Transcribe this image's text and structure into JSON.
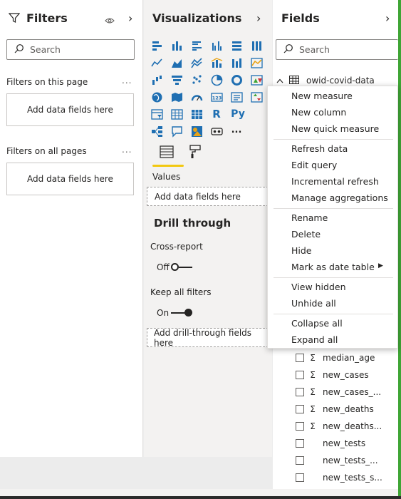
{
  "filters": {
    "title": "Filters",
    "search_placeholder": "Search",
    "on_this_page_label": "Filters on this page",
    "on_all_pages_label": "Filters on all pages",
    "add_fields_text": "Add data fields here",
    "more": "..."
  },
  "visualizations": {
    "title": "Visualizations",
    "values_label": "Values",
    "values_drop": "Add data fields here",
    "drill_title": "Drill through",
    "cross_report_label": "Cross-report",
    "cross_report_state": "Off",
    "keep_filters_label": "Keep all filters",
    "keep_filters_state": "On",
    "drill_drop": "Add drill-through fields here",
    "more_visuals": "...",
    "r_visual": "R",
    "py_visual": "Py"
  },
  "fields": {
    "title": "Fields",
    "search_placeholder": "Search",
    "table_name": "owid-covid-data",
    "items": [
      {
        "name": "median_age",
        "sigma": "Σ"
      },
      {
        "name": "new_cases",
        "sigma": "Σ"
      },
      {
        "name": "new_cases_...",
        "sigma": "Σ"
      },
      {
        "name": "new_deaths",
        "sigma": "Σ"
      },
      {
        "name": "new_deaths...",
        "sigma": "Σ"
      },
      {
        "name": "new_tests",
        "sigma": ""
      },
      {
        "name": "new_tests_...",
        "sigma": ""
      },
      {
        "name": "new_tests_s...",
        "sigma": ""
      }
    ]
  },
  "context_menu": {
    "items": [
      "New measure",
      "New column",
      "New quick measure",
      "Refresh data",
      "Edit query",
      "Incremental refresh",
      "Manage aggregations",
      "Rename",
      "Delete",
      "Hide",
      "Mark as date table",
      "View hidden",
      "Unhide all",
      "Collapse all",
      "Expand all"
    ]
  },
  "colors": {
    "accent_green": "#3fa535",
    "format_tab_underline": "#f2c811",
    "visual_icon_blue": "#1f6fb2",
    "visual_icon_gold": "#e8a317"
  }
}
